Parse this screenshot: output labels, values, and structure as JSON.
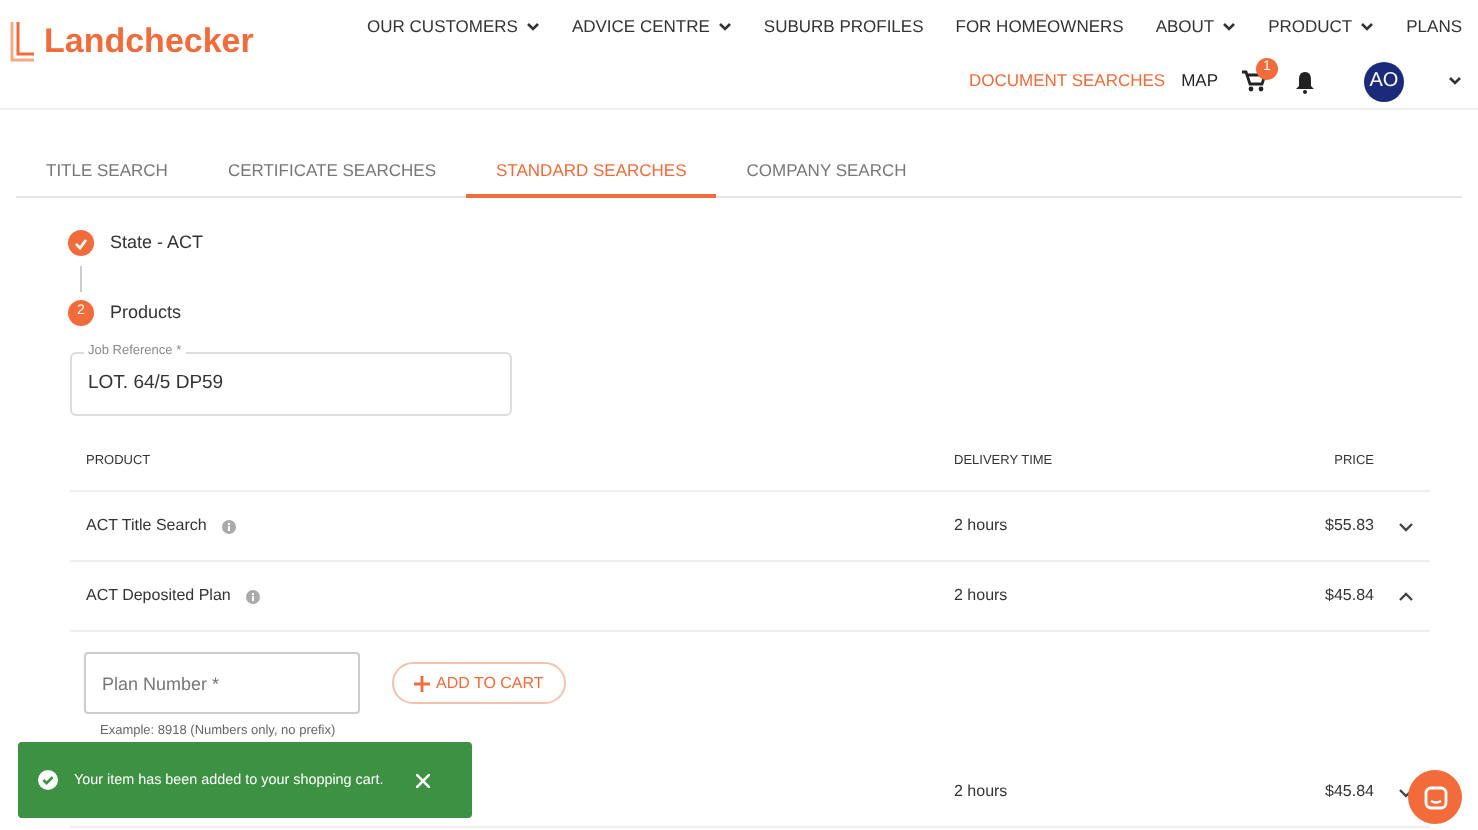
{
  "brand": {
    "name": "Landchecker"
  },
  "main_nav": [
    {
      "label": "OUR CUSTOMERS",
      "has_menu": true
    },
    {
      "label": "ADVICE CENTRE",
      "has_menu": true
    },
    {
      "label": "SUBURB PROFILES",
      "has_menu": false
    },
    {
      "label": "FOR HOMEOWNERS",
      "has_menu": false
    },
    {
      "label": "ABOUT",
      "has_menu": true
    },
    {
      "label": "PRODUCT",
      "has_menu": true
    },
    {
      "label": "PLANS",
      "has_menu": false
    }
  ],
  "secondary_nav": [
    {
      "label": "DOCUMENT SEARCHES",
      "selected": true
    },
    {
      "label": "MAP",
      "selected": false
    }
  ],
  "cart": {
    "count": "1"
  },
  "avatar": {
    "initials": "AO"
  },
  "tabs": [
    {
      "label": "TITLE SEARCH",
      "selected": false
    },
    {
      "label": "CERTIFICATE SEARCHES",
      "selected": false
    },
    {
      "label": "STANDARD SEARCHES",
      "selected": true
    },
    {
      "label": "COMPANY SEARCH",
      "selected": false
    }
  ],
  "steps": [
    {
      "label": "State - ACT",
      "completed": true
    },
    {
      "label": "Products",
      "completed": false,
      "number": "2"
    }
  ],
  "job_reference": {
    "label": "Job Reference *",
    "value": "LOT. 64/5 DP59"
  },
  "table": {
    "columns": [
      "PRODUCT",
      "DELIVERY TIME",
      "PRICE"
    ],
    "rows": [
      {
        "product": "ACT Title Search",
        "delivery": "2 hours",
        "price": "$55.83",
        "expanded": false,
        "detail": null
      },
      {
        "product": "ACT Deposited Plan",
        "delivery": "2 hours",
        "price": "$45.84",
        "expanded": true,
        "detail": {
          "placeholder": "Plan Number *",
          "hint": "Example: 8918 (Numbers only, no prefix)",
          "button": "ADD TO CART"
        }
      },
      {
        "product": null,
        "delivery": "2 hours",
        "price": "$45.84",
        "expanded": false,
        "detail": null
      }
    ]
  },
  "toast": {
    "message": "Your item has been added to your shopping cart."
  }
}
